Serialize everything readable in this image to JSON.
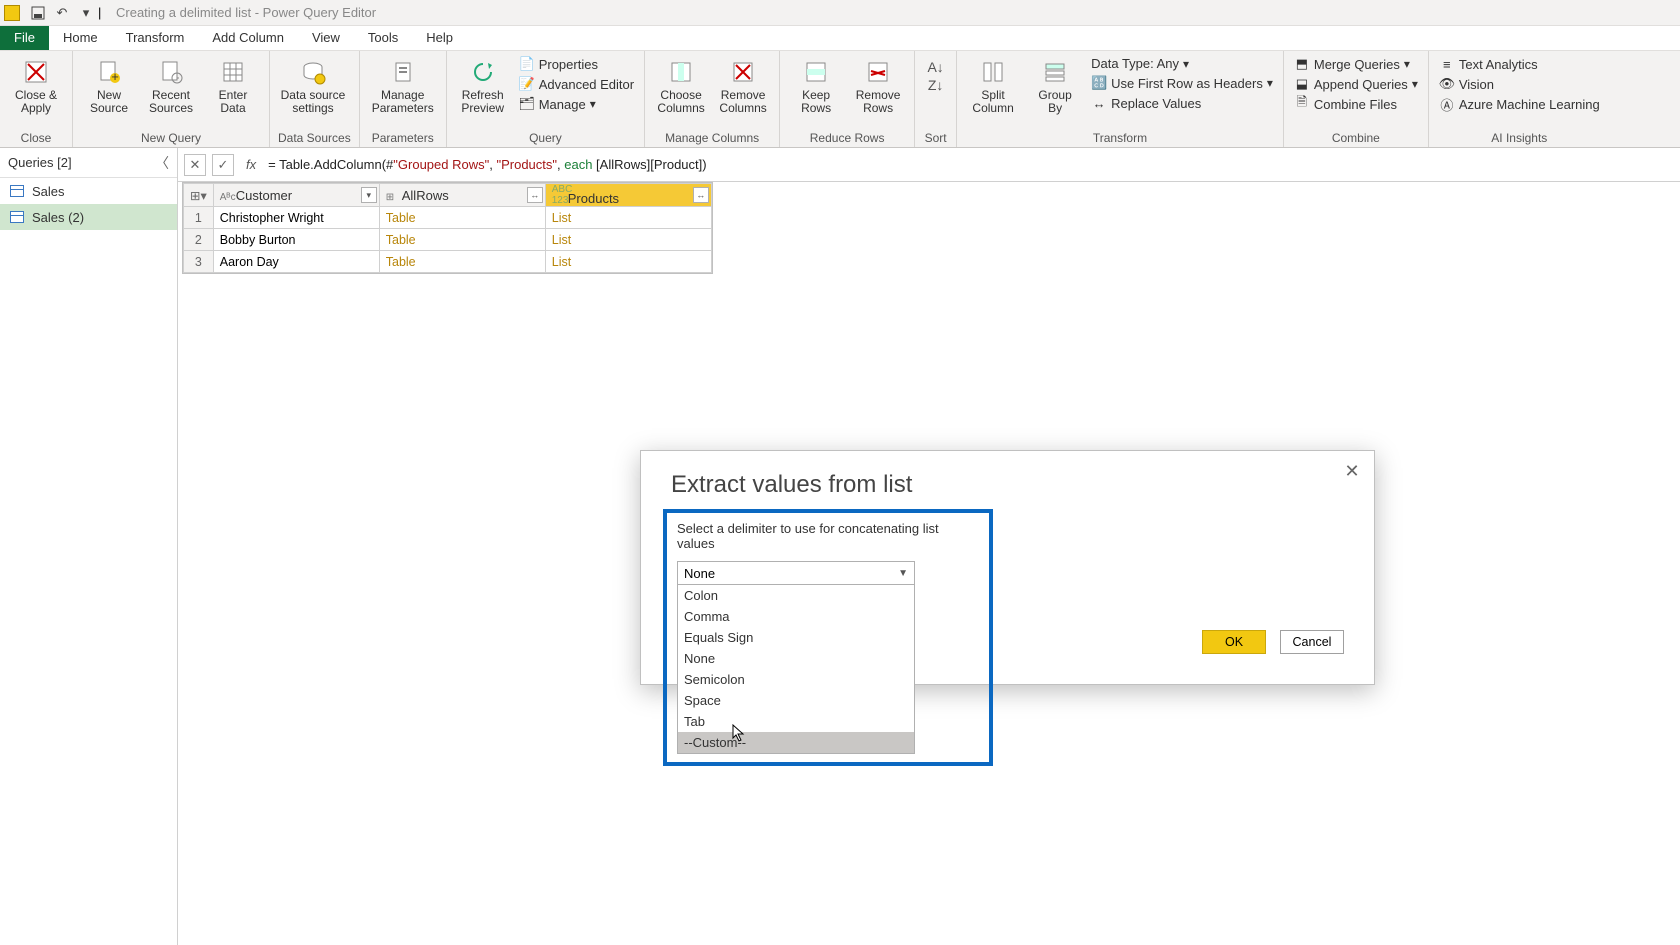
{
  "titlebar": {
    "title": "Creating a delimited list - Power Query Editor"
  },
  "menu": {
    "file": "File",
    "tabs": [
      "Home",
      "Transform",
      "Add Column",
      "View",
      "Tools",
      "Help"
    ]
  },
  "ribbon": {
    "close": {
      "close_apply": "Close &\nApply",
      "group": "Close"
    },
    "newquery": {
      "new_source": "New\nSource",
      "recent": "Recent\nSources",
      "enter": "Enter\nData",
      "group": "New Query"
    },
    "datasources": {
      "settings": "Data source\nsettings",
      "group": "Data Sources"
    },
    "parameters": {
      "manage": "Manage\nParameters",
      "group": "Parameters"
    },
    "query": {
      "refresh": "Refresh\nPreview",
      "properties": "Properties",
      "advanced": "Advanced Editor",
      "manage": "Manage",
      "group": "Query"
    },
    "managecols": {
      "choose": "Choose\nColumns",
      "remove": "Remove\nColumns",
      "group": "Manage Columns"
    },
    "reducerows": {
      "keep": "Keep\nRows",
      "removerows": "Remove\nRows",
      "group": "Reduce Rows"
    },
    "sort": {
      "group": "Sort"
    },
    "transform": {
      "split": "Split\nColumn",
      "groupby": "Group\nBy",
      "datatype": "Data Type: Any",
      "firstrow": "Use First Row as Headers",
      "replace": "Replace Values",
      "group": "Transform"
    },
    "combine": {
      "merge": "Merge Queries",
      "append": "Append Queries",
      "combinefiles": "Combine Files",
      "group": "Combine"
    },
    "ai": {
      "text": "Text Analytics",
      "vision": "Vision",
      "azure": "Azure Machine Learning",
      "group": "AI Insights"
    }
  },
  "queries": {
    "header": "Queries [2]",
    "items": [
      {
        "name": "Sales"
      },
      {
        "name": "Sales (2)"
      }
    ]
  },
  "formula": {
    "prefix": "= Table.AddColumn(#",
    "arg1": "\"Grouped Rows\"",
    "sep1": ", ",
    "arg2": "\"Products\"",
    "sep2": ", ",
    "each": "each",
    "rest": " [AllRows][Product])"
  },
  "grid": {
    "cols": [
      {
        "name": "Customer",
        "type": "ABC"
      },
      {
        "name": "AllRows",
        "type": "⊞"
      },
      {
        "name": "Products",
        "type": "ABC123"
      }
    ],
    "rows": [
      {
        "n": "1",
        "customer": "Christopher Wright",
        "allrows": "Table",
        "products": "List"
      },
      {
        "n": "2",
        "customer": "Bobby Burton",
        "allrows": "Table",
        "products": "List"
      },
      {
        "n": "3",
        "customer": "Aaron Day",
        "allrows": "Table",
        "products": "List"
      }
    ]
  },
  "dialog": {
    "title": "Extract values from list",
    "instruction": "Select a delimiter to use for concatenating list values",
    "selected": "None",
    "options": [
      "Colon",
      "Comma",
      "Equals Sign",
      "None",
      "Semicolon",
      "Space",
      "Tab",
      "--Custom--"
    ],
    "ok": "OK",
    "cancel": "Cancel"
  }
}
